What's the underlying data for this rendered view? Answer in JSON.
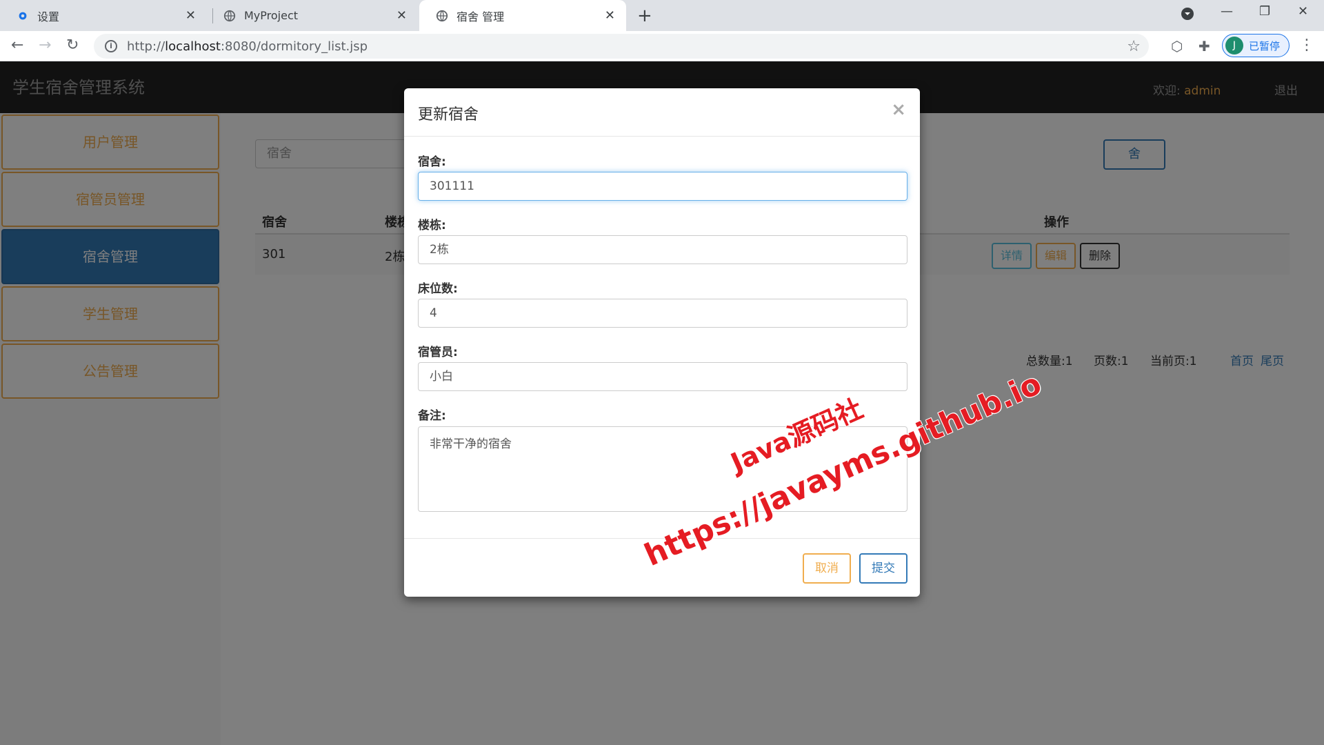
{
  "browser": {
    "tabs": [
      {
        "title": "设置",
        "icon": "gear-icon"
      },
      {
        "title": "MyProject",
        "icon": "globe-icon"
      },
      {
        "title": "宿舍 管理",
        "icon": "globe-icon"
      }
    ],
    "url_scheme": "http://",
    "url_host": "localhost",
    "url_rest": ":8080/dormitory_list.jsp",
    "profile_initial": "J",
    "profile_status": "已暂停"
  },
  "app": {
    "title": "学生宿舍管理系统",
    "welcome_label": "欢迎:",
    "username": "admin",
    "logout": "退出"
  },
  "sidebar": {
    "items": [
      {
        "label": "用户管理"
      },
      {
        "label": "宿管员管理"
      },
      {
        "label": "宿舍管理"
      },
      {
        "label": "学生管理"
      },
      {
        "label": "公告管理"
      }
    ]
  },
  "main": {
    "search_placeholder": "宿舍",
    "add_button": "舍",
    "table": {
      "headers": [
        "宿舍",
        "楼栋",
        "操作"
      ],
      "rows": [
        {
          "dorm": "301",
          "building": "2栋"
        }
      ],
      "row_actions": {
        "detail": "详情",
        "edit": "编辑",
        "delete": "删除"
      }
    },
    "pager": {
      "total": "总数量:1",
      "pages": "页数:1",
      "current": "当前页:1",
      "first": "首页",
      "last": "尾页"
    }
  },
  "modal": {
    "title": "更新宿舍",
    "close": "×",
    "fields": {
      "dorm_label": "宿舍:",
      "dorm_value": "301111",
      "building_label": "楼栋:",
      "building_value": "2栋",
      "beds_label": "床位数:",
      "beds_value": "4",
      "manager_label": "宿管员:",
      "manager_value": "小白",
      "remark_label": "备注:",
      "remark_value": "非常干净的宿舍"
    },
    "cancel": "取消",
    "submit": "提交"
  },
  "watermark": {
    "line1": "Java源码社",
    "line2": "https://javayms.github.io"
  },
  "colors": {
    "primary": "#337ab7",
    "warning": "#f0ad4e",
    "info": "#5bc0de",
    "navbar": "#222222",
    "watermark": "#e51c23"
  }
}
